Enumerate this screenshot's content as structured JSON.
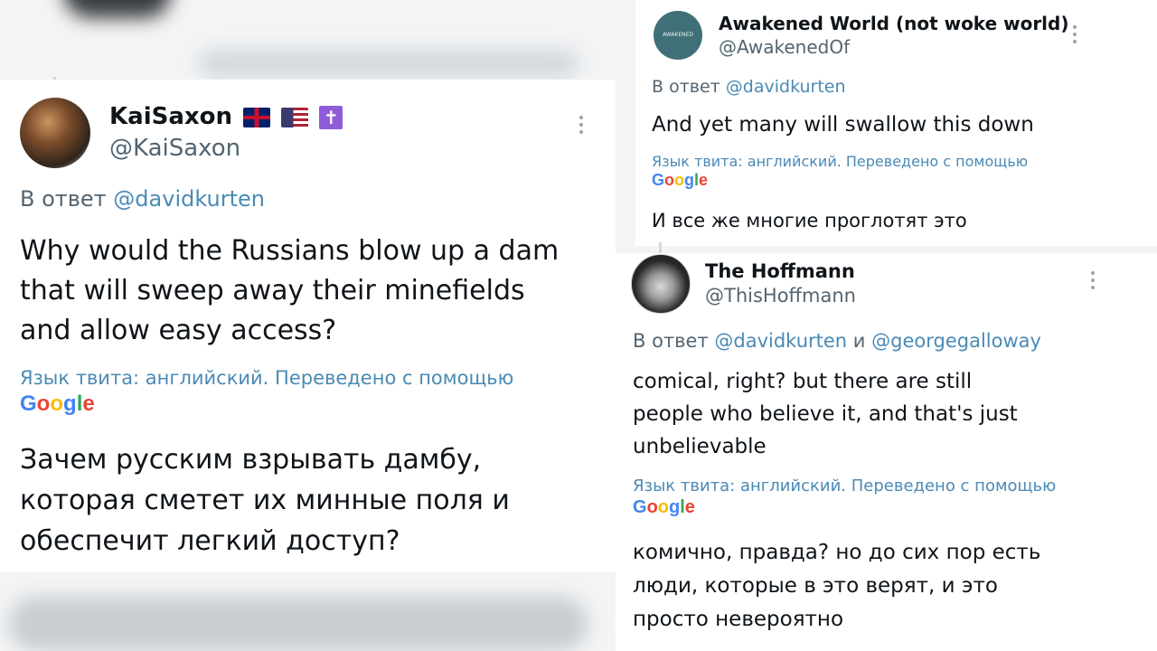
{
  "tweets": [
    {
      "name": "KaiSaxon",
      "handle": "@KaiSaxon",
      "reply_prefix": "В ответ",
      "reply_to": "@davidkurten",
      "text": "Why would the Russians blow up a dam\nthat will sweep away their minefields\nand allow easy access?",
      "translation_note": "Язык твита: английский. Переведено с помощью",
      "translated_text": "Зачем русским взрывать дамбу,\nкоторая сметет их минные поля и\nобеспечит легкий доступ?",
      "flags": [
        "uk-flag-icon",
        "us-flag-icon",
        "cross-icon"
      ]
    },
    {
      "name": "Awakened World (not woke world)",
      "handle": "@AwakenedOf",
      "avatar_text": "AWAKENED WORLD",
      "reply_prefix": "В ответ",
      "reply_to": "@davidkurten",
      "text": "And yet many will swallow this down",
      "translation_note": "Язык твита: английский. Переведено с помощью",
      "translated_text": "И все же многие проглотят это"
    },
    {
      "name": "The Hoffmann",
      "handle": "@ThisHoffmann",
      "reply_prefix": "В ответ",
      "reply_to": "@davidkurten",
      "reply_and": "и",
      "reply_to_2": "@georgegalloway",
      "text": "comical, right? but there are still\npeople who believe it, and that's just\nunbelievable",
      "translation_note": "Язык твита: английский. Переведено с помощью",
      "translated_text": "комично, правда? но до сих пор есть\nлюди, которые в это верят, и это\nпросто невероятно"
    }
  ],
  "google_logo": [
    "G",
    "o",
    "o",
    "g",
    "l",
    "e"
  ],
  "colors": {
    "mention": "#4a8ab5",
    "text": "#0f1419",
    "muted": "#536471",
    "awakened_avatar": "#3f6f77"
  }
}
